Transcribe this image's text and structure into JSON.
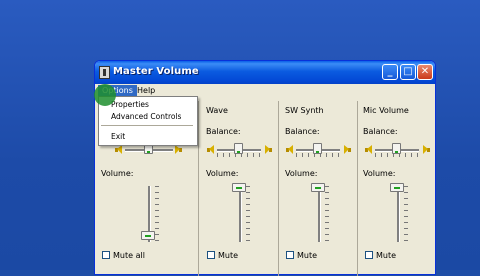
{
  "window": {
    "title": "Master Volume",
    "buttons": {
      "minimize": "_",
      "maximize": "□",
      "close": "✕"
    }
  },
  "menubar": {
    "items": [
      "Options",
      "Help"
    ]
  },
  "options_menu": {
    "items": [
      "Properties",
      "Advanced Controls",
      "Exit"
    ]
  },
  "columns": [
    {
      "name": "",
      "balance_label": "",
      "volume_label": "Volume:",
      "mute_label": "Mute all",
      "balance": 0.5,
      "volume": 0.05
    },
    {
      "name": "Wave",
      "balance_label": "Balance:",
      "volume_label": "Volume:",
      "mute_label": "Mute",
      "balance": 0.5,
      "volume": 1.0
    },
    {
      "name": "SW Synth",
      "balance_label": "Balance:",
      "volume_label": "Volume:",
      "mute_label": "Mute",
      "balance": 0.5,
      "volume": 1.0
    },
    {
      "name": "Mic Volume",
      "balance_label": "Balance:",
      "volume_label": "Volume:",
      "mute_label": "Mute",
      "balance": 0.5,
      "volume": 1.0
    }
  ],
  "icons": {
    "speaker_left": "speaker-left-icon",
    "speaker_right": "speaker-right-icon",
    "app": "volume-app-icon"
  },
  "colors": {
    "titlebar": "#0a5fe8",
    "menu_highlight": "#316ac5",
    "desktop": "#1f4ea6",
    "close": "#cb3a1a"
  }
}
